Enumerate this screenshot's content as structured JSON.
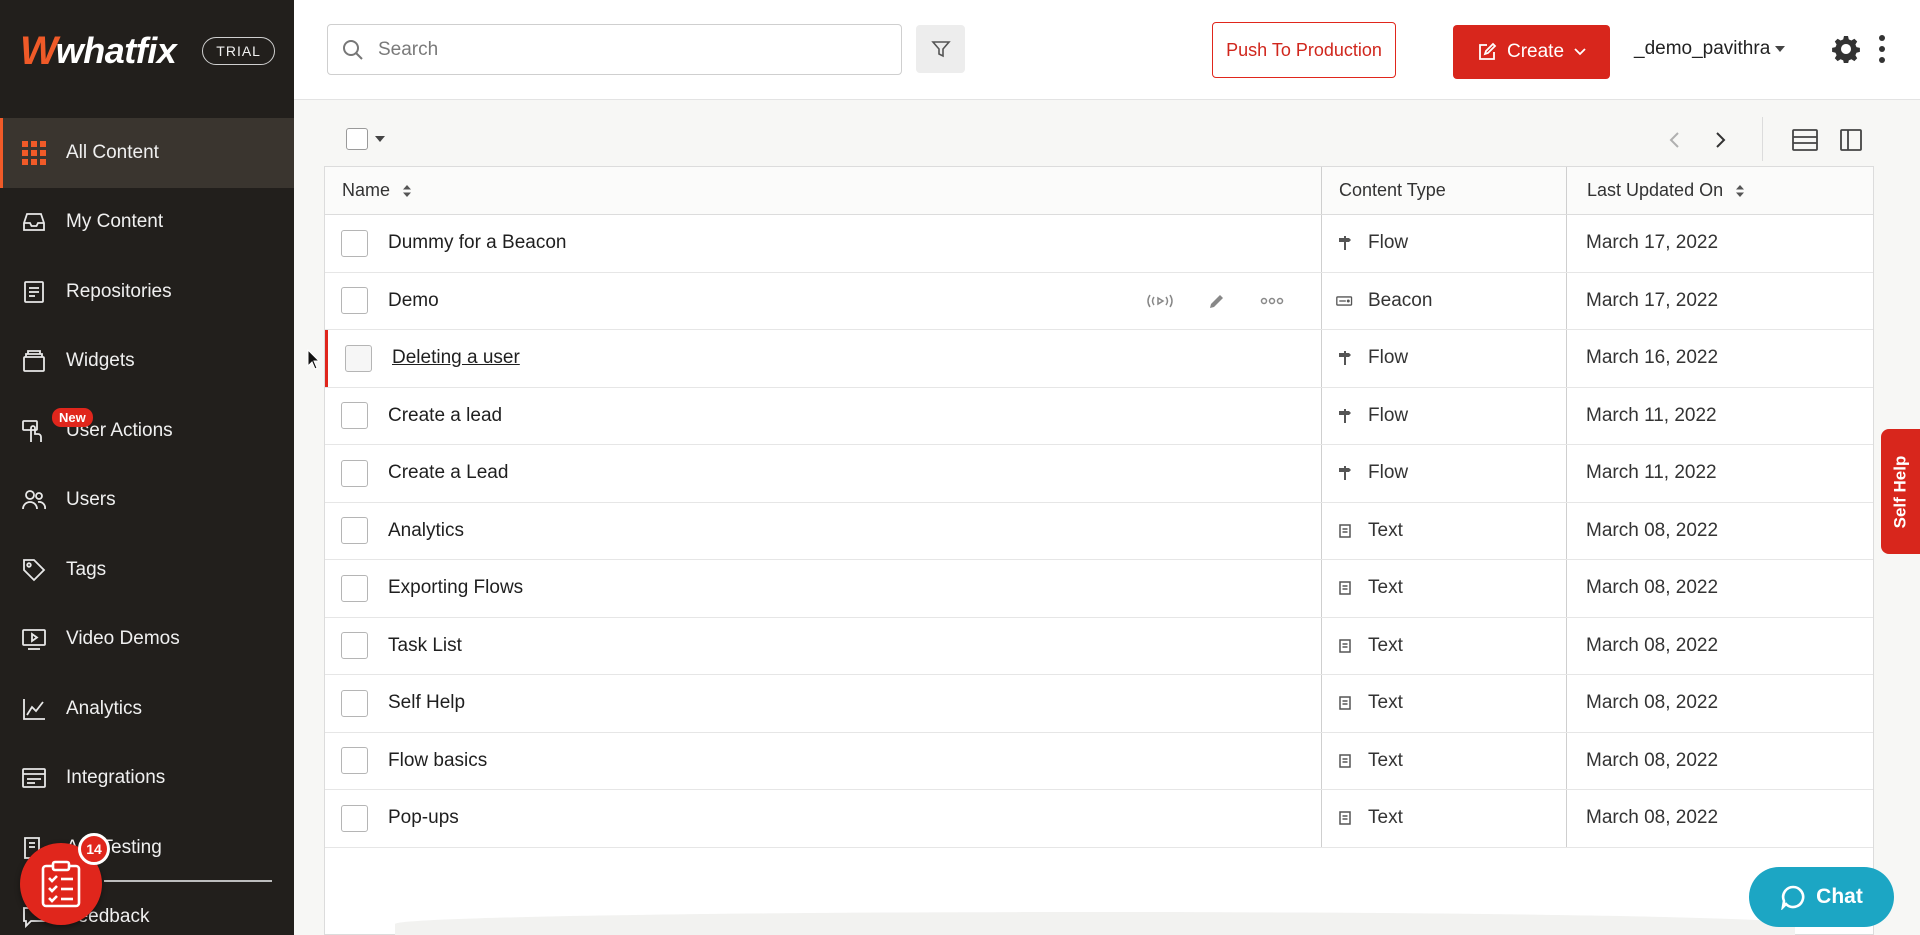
{
  "brand": {
    "logo_text": "whatfix",
    "trial_badge": "TRIAL"
  },
  "sidebar": {
    "items": [
      {
        "label": "All Content",
        "icon": "grid-icon",
        "active": true
      },
      {
        "label": "My Content",
        "icon": "inbox-icon"
      },
      {
        "label": "Repositories",
        "icon": "repository-icon"
      },
      {
        "label": "Widgets",
        "icon": "widgets-icon"
      },
      {
        "label": "User Actions",
        "icon": "hand-pointer-icon",
        "badge": "New"
      },
      {
        "label": "Users",
        "icon": "users-icon"
      },
      {
        "label": "Tags",
        "icon": "tag-icon"
      },
      {
        "label": "Video Demos",
        "icon": "video-icon"
      },
      {
        "label": "Analytics",
        "icon": "analytics-icon"
      },
      {
        "label": "Integrations",
        "icon": "integrations-icon"
      },
      {
        "label": "A/B Testing",
        "icon": "ab-testing-icon"
      },
      {
        "label": "Feedback",
        "icon": "feedback-icon"
      }
    ],
    "tasks_count": "14"
  },
  "header": {
    "search_placeholder": "Search",
    "push_label": "Push To Production",
    "create_label": "Create",
    "user_name": "_demo_pavithra"
  },
  "table": {
    "columns": {
      "name": "Name",
      "type": "Content Type",
      "date": "Last Updated On"
    },
    "rows": [
      {
        "name": "Dummy for a Beacon",
        "type": "Flow",
        "date": "March 17, 2022"
      },
      {
        "name": "Demo",
        "type": "Beacon",
        "date": "March 17, 2022"
      },
      {
        "name": "Deleting a user",
        "type": "Flow",
        "date": "March 16, 2022"
      },
      {
        "name": "Create a lead",
        "type": "Flow",
        "date": "March 11, 2022"
      },
      {
        "name": "Create a Lead",
        "type": "Flow",
        "date": "March 11, 2022"
      },
      {
        "name": "Analytics",
        "type": "Text",
        "date": "March 08, 2022"
      },
      {
        "name": "Exporting Flows",
        "type": "Text",
        "date": "March 08, 2022"
      },
      {
        "name": "Task List",
        "type": "Text",
        "date": "March 08, 2022"
      },
      {
        "name": "Self Help",
        "type": "Text",
        "date": "March 08, 2022"
      },
      {
        "name": "Flow basics",
        "type": "Text",
        "date": "March 08, 2022"
      },
      {
        "name": "Pop-ups",
        "type": "Text",
        "date": "March 08, 2022"
      }
    ]
  },
  "self_help_label": "Self Help",
  "chat_label": "Chat",
  "colors": {
    "accent": "#d8261c",
    "brand_orange": "#f05a28",
    "sidebar_bg": "#221f1c",
    "chat": "#1ca6c4"
  }
}
